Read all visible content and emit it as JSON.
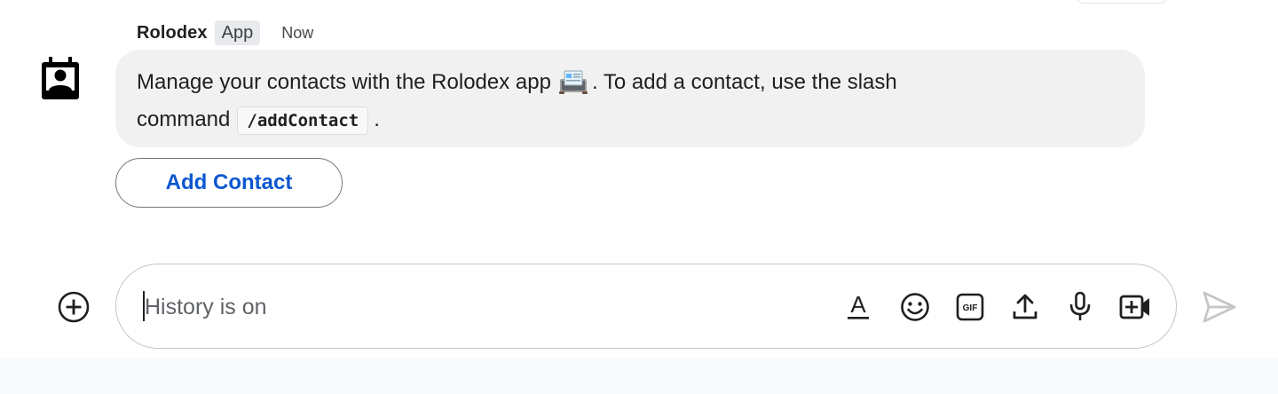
{
  "message": {
    "sender": "Rolodex",
    "badge": "App",
    "time": "Now",
    "avatar_icon": "contact-card-icon",
    "text_before_emoji": "Manage your contacts with the Rolodex app",
    "emoji": "rolodex-emoji",
    "text_after_emoji": ". To add a contact, use the slash command",
    "code": "/addContact",
    "text_end": "."
  },
  "card": {
    "add_contact_label": "Add Contact"
  },
  "composer": {
    "placeholder": "History is on",
    "tools": [
      "format-text-icon",
      "emoji-icon",
      "gif-icon",
      "upload-icon",
      "mic-icon",
      "video-meeting-icon"
    ],
    "add_icon": "add-circle-icon",
    "send_icon": "send-icon"
  },
  "colors": {
    "accent": "#0b57d0",
    "bubble": "#f1f1f1",
    "badge": "#e8eaed"
  }
}
